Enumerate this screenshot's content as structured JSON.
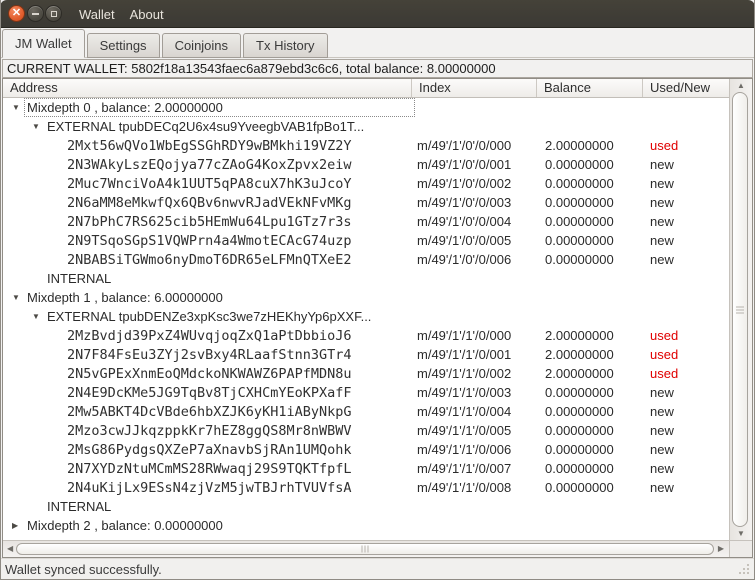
{
  "titlebar": {
    "menu": [
      "Wallet",
      "About"
    ],
    "window_buttons": [
      "close",
      "minimize",
      "maximize"
    ]
  },
  "tabs": {
    "items": [
      "JM Wallet",
      "Settings",
      "Coinjoins",
      "Tx History"
    ],
    "active": "JM Wallet"
  },
  "wallet_header": "CURRENT WALLET: 5802f18a13543faec6a879ebd3c6c6, total balance: 8.00000000",
  "tree": {
    "columns": [
      "Address",
      "Index",
      "Balance",
      "Used/New"
    ],
    "rows": [
      {
        "level": 0,
        "expanded": true,
        "focused": true,
        "address": "Mixdepth 0 , balance: 2.00000000",
        "index": "",
        "balance": "",
        "status": "",
        "mono": false
      },
      {
        "level": 1,
        "expanded": true,
        "address": "EXTERNAL tpubDECq2U6x4su9YveegbVAB1fpBo1T...",
        "index": "",
        "balance": "",
        "status": "",
        "mono": false
      },
      {
        "level": 2,
        "mono": true,
        "address": "2Mxt56wQVo1WbEgSSGhRDY9wBMkhi19VZ2Y",
        "index": "m/49'/1'/0'/0/000",
        "balance": "2.00000000",
        "status": "used"
      },
      {
        "level": 2,
        "mono": true,
        "address": "2N3WAkyLszEQojya77cZAoG4KoxZpvx2eiw",
        "index": "m/49'/1'/0'/0/001",
        "balance": "0.00000000",
        "status": "new"
      },
      {
        "level": 2,
        "mono": true,
        "address": "2Muc7WnciVoA4k1UUT5qPA8cuX7hK3uJcoY",
        "index": "m/49'/1'/0'/0/002",
        "balance": "0.00000000",
        "status": "new"
      },
      {
        "level": 2,
        "mono": true,
        "address": "2N6aMM8eMkwfQx6QBv6nwvRJadVEkNFvMKg",
        "index": "m/49'/1'/0'/0/003",
        "balance": "0.00000000",
        "status": "new"
      },
      {
        "level": 2,
        "mono": true,
        "address": "2N7bPhC7RS625cib5HEmWu64Lpu1GTz7r3s",
        "index": "m/49'/1'/0'/0/004",
        "balance": "0.00000000",
        "status": "new"
      },
      {
        "level": 2,
        "mono": true,
        "address": "2N9TSqoSGpS1VQWPrn4a4WmotECAcG74uzp",
        "index": "m/49'/1'/0'/0/005",
        "balance": "0.00000000",
        "status": "new"
      },
      {
        "level": 2,
        "mono": true,
        "address": "2NBABSiTGWmo6nyDmoT6DR65eLFMnQTXeE2",
        "index": "m/49'/1'/0'/0/006",
        "balance": "0.00000000",
        "status": "new"
      },
      {
        "level": 1,
        "address": "INTERNAL",
        "index": "",
        "balance": "",
        "status": "",
        "mono": false
      },
      {
        "level": 0,
        "expanded": true,
        "address": "Mixdepth 1 , balance: 6.00000000",
        "index": "",
        "balance": "",
        "status": "",
        "mono": false
      },
      {
        "level": 1,
        "expanded": true,
        "address": "EXTERNAL tpubDENZe3xpKsc3we7zHEKhyYp6pXXF...",
        "index": "",
        "balance": "",
        "status": "",
        "mono": false
      },
      {
        "level": 2,
        "mono": true,
        "address": "2MzBvdjd39PxZ4WUvqjoqZxQ1aPtDbbioJ6",
        "index": "m/49'/1'/1'/0/000",
        "balance": "2.00000000",
        "status": "used"
      },
      {
        "level": 2,
        "mono": true,
        "address": "2N7F84FsEu3ZYj2svBxy4RLaafStnn3GTr4",
        "index": "m/49'/1'/1'/0/001",
        "balance": "2.00000000",
        "status": "used"
      },
      {
        "level": 2,
        "mono": true,
        "address": "2N5vGPExXnmEoQMdckoNKWAWZ6PAPfMDN8u",
        "index": "m/49'/1'/1'/0/002",
        "balance": "2.00000000",
        "status": "used"
      },
      {
        "level": 2,
        "mono": true,
        "address": "2N4E9DcKMe5JG9TqBv8TjCXHCmYEoKPXafF",
        "index": "m/49'/1'/1'/0/003",
        "balance": "0.00000000",
        "status": "new"
      },
      {
        "level": 2,
        "mono": true,
        "address": "2Mw5ABKT4DcVBde6hbXZJK6yKH1iAByNkpG",
        "index": "m/49'/1'/1'/0/004",
        "balance": "0.00000000",
        "status": "new"
      },
      {
        "level": 2,
        "mono": true,
        "address": "2Mzo3cwJJkqzppkKr7hEZ8ggQS8Mr8nWBWV",
        "index": "m/49'/1'/1'/0/005",
        "balance": "0.00000000",
        "status": "new"
      },
      {
        "level": 2,
        "mono": true,
        "address": "2MsG86PydgsQXZeP7aXnavbSjRAn1UMQohk",
        "index": "m/49'/1'/1'/0/006",
        "balance": "0.00000000",
        "status": "new"
      },
      {
        "level": 2,
        "mono": true,
        "address": "2N7XYDzNtuMCmMS28RWwaqj29S9TQKTfpfL",
        "index": "m/49'/1'/1'/0/007",
        "balance": "0.00000000",
        "status": "new"
      },
      {
        "level": 2,
        "mono": true,
        "address": "2N4uKijLx9ESsN4zjVzM5jwTBJrhTVUVfsA",
        "index": "m/49'/1'/1'/0/008",
        "balance": "0.00000000",
        "status": "new"
      },
      {
        "level": 1,
        "address": "INTERNAL",
        "index": "",
        "balance": "",
        "status": "",
        "mono": false
      },
      {
        "level": 0,
        "expanded": false,
        "address": "Mixdepth 2 , balance: 0.00000000",
        "index": "",
        "balance": "",
        "status": "",
        "mono": false
      }
    ]
  },
  "statusbar": {
    "text": "Wallet synced successfully."
  },
  "colors": {
    "used": "#e00000",
    "new": "#2b2b2b",
    "close_button": "#e9572c",
    "titlebar": "#3c3a36"
  }
}
